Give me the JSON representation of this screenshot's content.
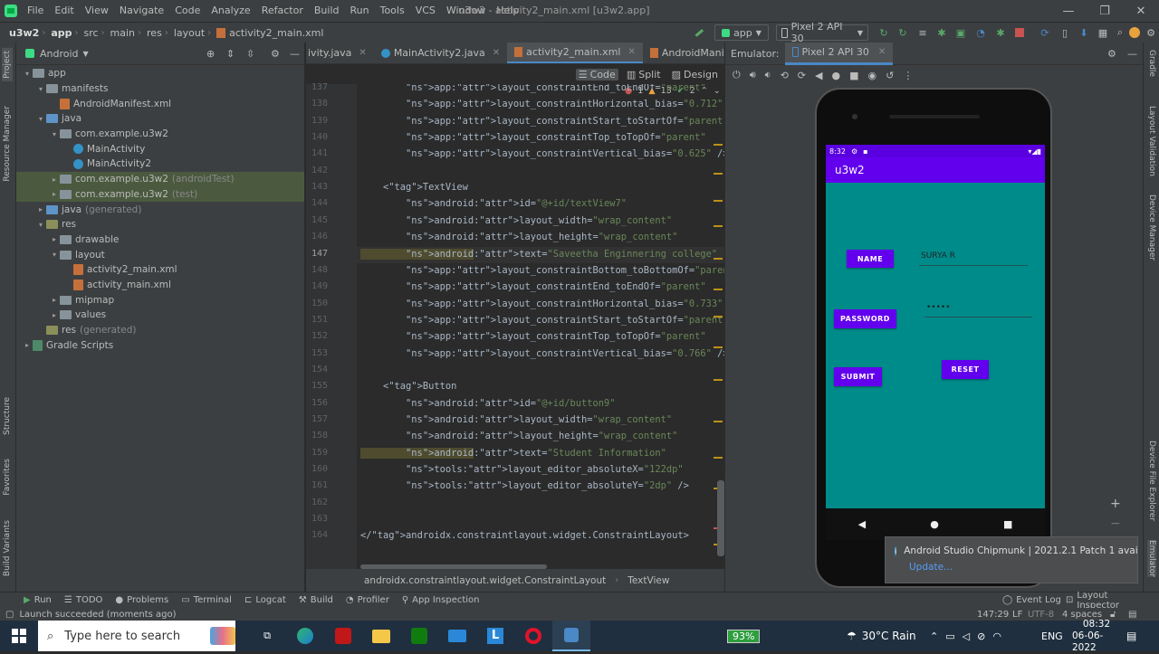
{
  "menu": {
    "items": [
      "File",
      "Edit",
      "View",
      "Navigate",
      "Code",
      "Analyze",
      "Refactor",
      "Build",
      "Run",
      "Tools",
      "VCS",
      "Window",
      "Help"
    ],
    "title": "u3w2 - activity2_main.xml [u3w2.app]"
  },
  "breadcrumb": [
    "u3w2",
    "app",
    "src",
    "main",
    "res",
    "layout",
    "activity2_main.xml"
  ],
  "toolbar": {
    "config": "app",
    "device": "Pixel 2 API 30"
  },
  "project": {
    "view": "Android",
    "tree": [
      {
        "label": "app",
        "suffix": "",
        "depth": 0,
        "arrow": "▾",
        "icon": "folder",
        "hl": false
      },
      {
        "label": "manifests",
        "suffix": "",
        "depth": 1,
        "arrow": "▾",
        "icon": "folder",
        "hl": false
      },
      {
        "label": "AndroidManifest.xml",
        "suffix": "",
        "depth": 2,
        "arrow": "",
        "icon": "xml",
        "hl": false
      },
      {
        "label": "java",
        "suffix": "",
        "depth": 1,
        "arrow": "▾",
        "icon": "folder-blue",
        "hl": false
      },
      {
        "label": "com.example.u3w2",
        "suffix": "",
        "depth": 2,
        "arrow": "▾",
        "icon": "folder",
        "hl": false
      },
      {
        "label": "MainActivity",
        "suffix": "",
        "depth": 3,
        "arrow": "",
        "icon": "class",
        "hl": false
      },
      {
        "label": "MainActivity2",
        "suffix": "",
        "depth": 3,
        "arrow": "",
        "icon": "class",
        "hl": false
      },
      {
        "label": "com.example.u3w2",
        "suffix": "(androidTest)",
        "depth": 2,
        "arrow": "▸",
        "icon": "folder",
        "hl": true
      },
      {
        "label": "com.example.u3w2",
        "suffix": "(test)",
        "depth": 2,
        "arrow": "▸",
        "icon": "folder",
        "hl": true
      },
      {
        "label": "java",
        "suffix": "(generated)",
        "depth": 1,
        "arrow": "▸",
        "icon": "folder-blue",
        "hl": false,
        "greyLabel": true
      },
      {
        "label": "res",
        "suffix": "",
        "depth": 1,
        "arrow": "▾",
        "icon": "folder-res",
        "hl": false
      },
      {
        "label": "drawable",
        "suffix": "",
        "depth": 2,
        "arrow": "▸",
        "icon": "folder",
        "hl": false
      },
      {
        "label": "layout",
        "suffix": "",
        "depth": 2,
        "arrow": "▾",
        "icon": "folder",
        "hl": false
      },
      {
        "label": "activity2_main.xml",
        "suffix": "",
        "depth": 3,
        "arrow": "",
        "icon": "layout",
        "hl": false
      },
      {
        "label": "activity_main.xml",
        "suffix": "",
        "depth": 3,
        "arrow": "",
        "icon": "layout",
        "hl": false
      },
      {
        "label": "mipmap",
        "suffix": "",
        "depth": 2,
        "arrow": "▸",
        "icon": "folder",
        "hl": false
      },
      {
        "label": "values",
        "suffix": "",
        "depth": 2,
        "arrow": "▸",
        "icon": "folder",
        "hl": false
      },
      {
        "label": "res",
        "suffix": "(generated)",
        "depth": 1,
        "arrow": "",
        "icon": "folder-res",
        "hl": false
      },
      {
        "label": "Gradle Scripts",
        "suffix": "",
        "depth": 0,
        "arrow": "▸",
        "icon": "gradle",
        "hl": false
      }
    ]
  },
  "tabs": [
    {
      "label": "ivity.java",
      "active": false
    },
    {
      "label": "MainActivity2.java",
      "active": false
    },
    {
      "label": "activity2_main.xml",
      "active": true
    },
    {
      "label": "AndroidManifest.xml",
      "active": false
    }
  ],
  "views": {
    "code": "Code",
    "split": "Split",
    "design": "Design"
  },
  "inspections": {
    "errors": "1",
    "warnings": "13",
    "ok": "2"
  },
  "code": {
    "start": 137,
    "current": 147,
    "lines": [
      "        app:layout_constraintEnd_toEndOf=\"parent\"",
      "        app:layout_constraintHorizontal_bias=\"0.712\"",
      "        app:layout_constraintStart_toStartOf=\"parent\"",
      "        app:layout_constraintTop_toTopOf=\"parent\"",
      "        app:layout_constraintVertical_bias=\"0.625\" />",
      "",
      "    <TextView",
      "        android:id=\"@+id/textView7\"",
      "        android:layout_width=\"wrap_content\"",
      "        android:layout_height=\"wrap_content\"",
      "        android:text=\"Saveetha Enginnering college\"",
      "        app:layout_constraintBottom_toBottomOf=\"parent\"",
      "        app:layout_constraintEnd_toEndOf=\"parent\"",
      "        app:layout_constraintHorizontal_bias=\"0.733\"",
      "        app:layout_constraintStart_toStartOf=\"parent\"",
      "        app:layout_constraintTop_toTopOf=\"parent\"",
      "        app:layout_constraintVertical_bias=\"0.766\" />",
      "",
      "    <Button",
      "        android:id=\"@+id/button9\"",
      "        android:layout_width=\"wrap_content\"",
      "        android:layout_height=\"wrap_content\"",
      "        android:text=\"Student Information\"",
      "        tools:layout_editor_absoluteX=\"122dp\"",
      "        tools:layout_editor_absoluteY=\"2dp\" />",
      "",
      "",
      "</androidx.constraintlayout.widget.ConstraintLayout>"
    ]
  },
  "editor_breadcrumb": [
    "androidx.constraintlayout.widget.ConstraintLayout",
    "TextView"
  ],
  "emulator": {
    "label": "Emulator:",
    "device": "Pixel 2 API 30",
    "time": "8:32",
    "app_title": "u3w2",
    "buttons": {
      "name": "NAME",
      "password": "PASSWORD",
      "submit": "SUBMIT",
      "reset": "RESET"
    },
    "name_value": "SURYA R",
    "password_value": "•••••"
  },
  "notification": {
    "title": "Android Studio Chipmunk | 2021.2.1 Patch 1 avail",
    "link": "Update..."
  },
  "bottom_tools": [
    "Run",
    "TODO",
    "Problems",
    "Terminal",
    "Logcat",
    "Build",
    "Profiler",
    "App Inspection"
  ],
  "bottom_right": [
    "Event Log",
    "Layout Inspector"
  ],
  "status": {
    "message": "Launch succeeded (moments ago)",
    "position": "147:29",
    "lf": "LF",
    "encoding": "UTF-8",
    "indent": "4 spaces"
  },
  "taskbar": {
    "search": "Type here to search",
    "battery": "93%",
    "weather": "30°C  Rain",
    "lang": "ENG",
    "time": "08:32",
    "date": "06-06-2022"
  },
  "left_strip": [
    "Project",
    "Resource Manager",
    "Structure",
    "Favorites",
    "Build Variants"
  ],
  "right_strip": [
    "Gradle",
    "Layout Validation",
    "Device Manager",
    "Device File Explorer",
    "Emulator"
  ],
  "colors": {
    "accent": "#4a88c7",
    "purple": "#6200ee",
    "teal": "#008b8b"
  }
}
